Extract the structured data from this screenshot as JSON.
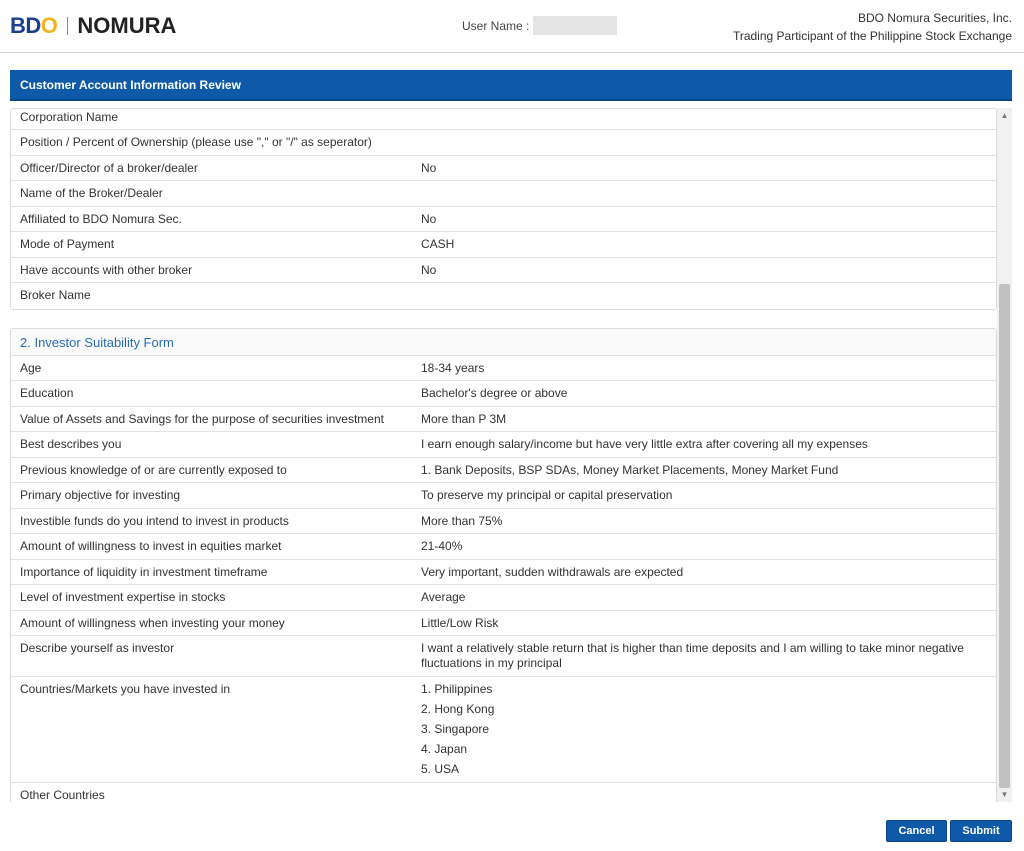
{
  "header": {
    "logo_bdo_b": "B",
    "logo_bdo_d": "D",
    "logo_bdo_o": "O",
    "logo_nomura": "NOMURA",
    "user_label": "User Name :",
    "company_line1": "BDO Nomura Securities, Inc.",
    "company_line2": "Trading Participant of the Philippine Stock Exchange"
  },
  "colors": {
    "brand_blue": "#0f5aa8",
    "logo_gold": "#f2b21b",
    "section_title": "#2a6db5"
  },
  "panel": {
    "title": "Customer Account Information Review"
  },
  "section1": {
    "rows": [
      {
        "label": "Corporation Name",
        "value": ""
      },
      {
        "label": "Position / Percent of Ownership (please use \",\" or \"/\" as seperator)",
        "value": ""
      },
      {
        "label": "Officer/Director of a broker/dealer",
        "value": "No"
      },
      {
        "label": "Name of the Broker/Dealer",
        "value": ""
      },
      {
        "label": "Affiliated to BDO Nomura Sec.",
        "value": "No"
      },
      {
        "label": "Mode of Payment",
        "value": "CASH"
      },
      {
        "label": "Have accounts with other broker",
        "value": "No"
      },
      {
        "label": "Broker Name",
        "value": ""
      }
    ]
  },
  "section2": {
    "title": "2. Investor Suitability Form",
    "rows": [
      {
        "label": "Age",
        "value": "18-34 years"
      },
      {
        "label": "Education",
        "value": "Bachelor's degree or above"
      },
      {
        "label": "Value of Assets and Savings for the purpose of securities investment",
        "value": "More than P 3M"
      },
      {
        "label": "Best describes you",
        "value": "I earn enough salary/income but have very little extra after covering all my expenses"
      },
      {
        "label": "Previous knowledge of or are currently exposed to",
        "value": "1. Bank Deposits, BSP SDAs, Money Market Placements, Money Market Fund"
      },
      {
        "label": "Primary objective for investing",
        "value": "To preserve my principal or capital preservation"
      },
      {
        "label": "Investible funds do you intend to invest in products",
        "value": "More than 75%"
      },
      {
        "label": "Amount of willingness to invest in equities market",
        "value": "21-40%"
      },
      {
        "label": "Importance of liquidity in investment timeframe",
        "value": "Very important, sudden withdrawals are expected"
      },
      {
        "label": "Level of investment expertise in stocks",
        "value": "Average"
      },
      {
        "label": "Amount of willingness when investing your money",
        "value": "Little/Low Risk"
      },
      {
        "label": "Describe yourself as investor",
        "value": "I want a relatively stable return that is higher than time deposits and I am willing to take minor negative fluctuations in my principal"
      },
      {
        "label": "Countries/Markets you have invested in",
        "values": [
          "1. Philippines",
          "2. Hong Kong",
          "3. Singapore",
          "4. Japan",
          "5. USA"
        ]
      },
      {
        "label": "Other Countries",
        "value": ""
      }
    ]
  },
  "buttons": {
    "cancel": "Cancel",
    "submit": "Submit"
  }
}
